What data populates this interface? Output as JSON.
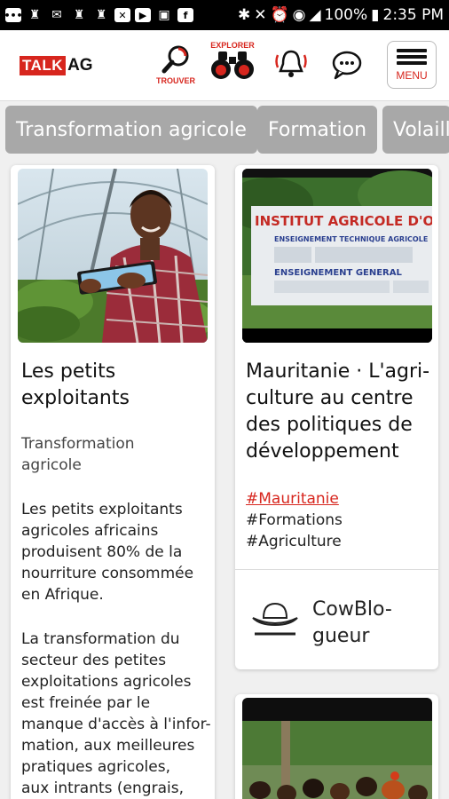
{
  "status_bar": {
    "battery": "100%",
    "time": "2:35 PM"
  },
  "header": {
    "logo_talk": "TALK",
    "logo_ag": "AG",
    "trouver_label": "TROUVER",
    "explorer_label": "EXPLORER",
    "menu_label": "MENU"
  },
  "categories": [
    "Transformation agricole",
    "Formation",
    "Volaill"
  ],
  "left_card": {
    "title_line1": "Les petits",
    "title_line2": "exploitants",
    "category_line1": "Transformation",
    "category_line2": "agricole",
    "excerpt1": [
      "Les petits exploitants",
      "agricoles africains",
      "produisent 80% de la",
      "nourriture consommée",
      "en Afrique."
    ],
    "excerpt2": [
      "La transformation du",
      "secteur des petites",
      "exploitations agricoles",
      "est freinée par le",
      "manque d'accès à l'infor-",
      "mation, aux meilleures",
      "pratiques agricoles,",
      "aux intrants (engrais,"
    ]
  },
  "right_card": {
    "sign_line1": "INSTITUT AGRICOLE D'OBAL",
    "sign_line2": "ENSEIGNEMENT TECHNIQUE AGRICOLE",
    "sign_line3": "ENSEIGNEMENT GENERAL",
    "title_lines": [
      "Mauritanie · L'agri-",
      "culture au centre",
      "des politiques de",
      "développement"
    ],
    "tags": [
      "#Mauritanie",
      "#Formations",
      "#Agriculture"
    ],
    "author_line1": "CowBlo-",
    "author_line2": "gueur"
  },
  "colors": {
    "brand_red": "#d7261e",
    "chip_gray": "#a8a8a8"
  }
}
